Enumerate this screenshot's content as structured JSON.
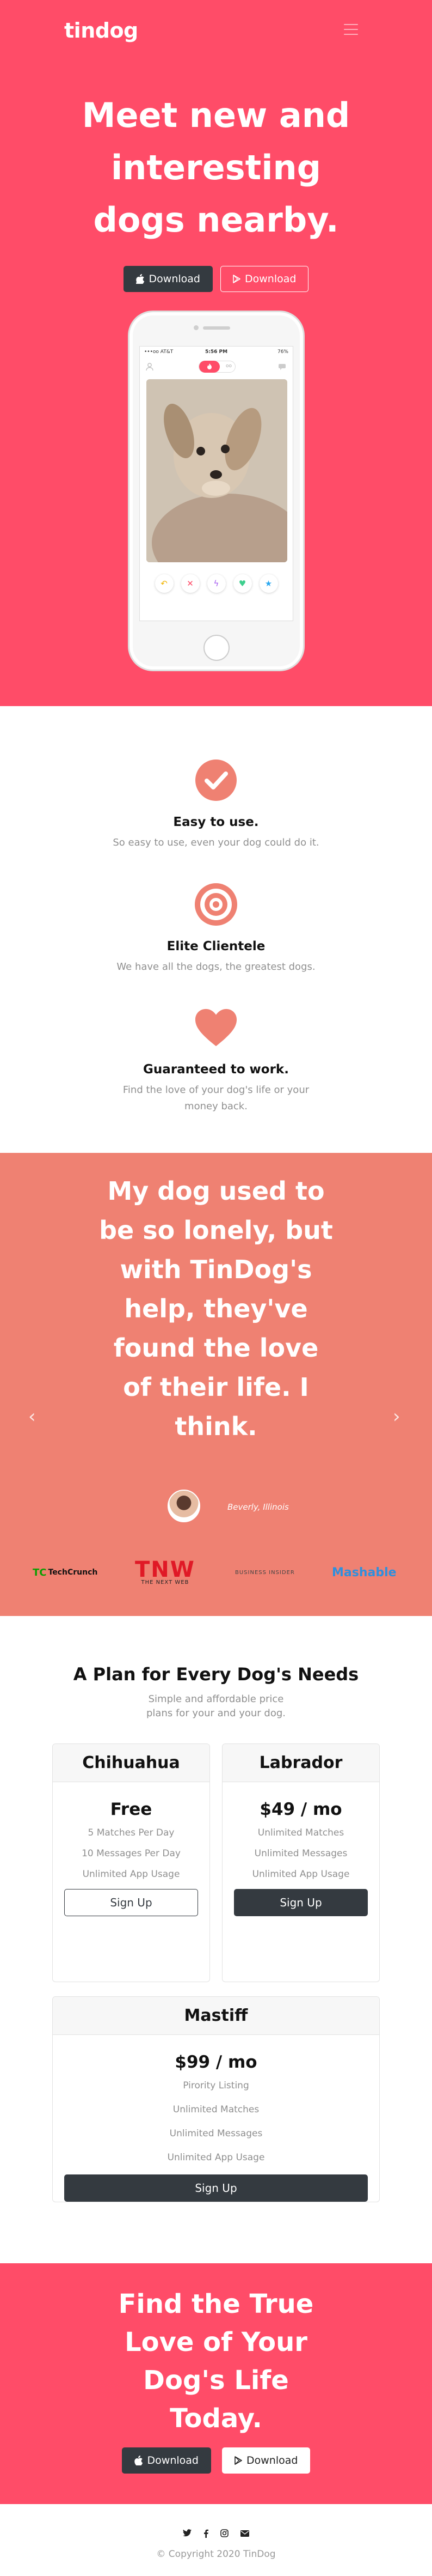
{
  "nav": {
    "brand": "tindog",
    "menu_icon": "hamburger-icon"
  },
  "hero": {
    "title": "Meet new and interesting dogs nearby.",
    "download_apple": "Download",
    "download_play": "Download"
  },
  "phone": {
    "carrier": "•••oo AT&T",
    "time": "5:56 PM",
    "battery": "76%",
    "toggle_on_icon": "flame-icon",
    "toggle_off": "oo"
  },
  "features": [
    {
      "title": "Easy to use.",
      "text": "So easy to use, even your dog could do it.",
      "icon": "check-circle-icon"
    },
    {
      "title": "Elite Clientele",
      "text": "We have all the dogs, the greatest dogs.",
      "icon": "bullseye-icon"
    },
    {
      "title": "Guaranteed to work.",
      "text": "Find the love of your dog's life or your money back.",
      "icon": "heart-icon"
    }
  ],
  "testimonial": {
    "quote": "My dog used to be so lonely, but with TinDog's help, they've found the love of their life. I think.",
    "author": "Beverly, Illinois"
  },
  "press": {
    "techcrunch": "TechCrunch",
    "tnw_big": "TNW",
    "tnw_small": "THE NEXT WEB",
    "bi": "BUSINESS INSIDER",
    "mashable": "Mashable"
  },
  "pricing": {
    "title": "A Plan for Every Dog's Needs",
    "subtitle": "Simple and affordable price plans for your and your dog.",
    "plans": [
      {
        "name": "Chihuahua",
        "price": "Free",
        "features": [
          "5 Matches Per Day",
          "10 Messages Per Day",
          "Unlimited App Usage"
        ],
        "button": "Sign Up"
      },
      {
        "name": "Labrador",
        "price": "$49 / mo",
        "features": [
          "Unlimited Matches",
          "Unlimited Messages",
          "Unlimited App Usage"
        ],
        "button": "Sign Up"
      },
      {
        "name": "Mastiff",
        "price": "$99 / mo",
        "features": [
          "Pirority Listing",
          "Unlimited Matches",
          "Unlimited Messages",
          "Unlimited App Usage"
        ],
        "button": "Sign Up"
      }
    ]
  },
  "cta": {
    "title": "Find the True Love of Your Dog's Life Today.",
    "download_apple": "Download",
    "download_play": "Download"
  },
  "footer": {
    "copyright": "© Copyright 2020 TinDog"
  },
  "colors": {
    "primary": "#ff4c68",
    "testimonial_bg": "#ef8172",
    "dark": "#343a40"
  }
}
